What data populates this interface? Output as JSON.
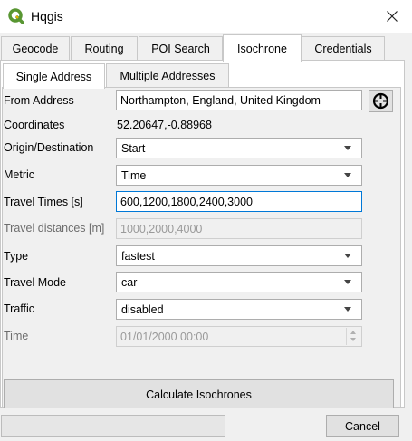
{
  "window": {
    "title": "Hqgis"
  },
  "tabs": [
    "Geocode",
    "Routing",
    "POI Search",
    "Isochrone",
    "Credentials"
  ],
  "active_tab": "Isochrone",
  "subtabs": [
    "Single Address",
    "Multiple Addresses"
  ],
  "active_subtab": "Single Address",
  "form": {
    "from_address": {
      "label": "From Address",
      "value": "Northampton, England, United Kingdom"
    },
    "coordinates": {
      "label": "Coordinates",
      "value": "52.20647,-0.88968"
    },
    "origin_destination": {
      "label": "Origin/Destination",
      "value": "Start"
    },
    "metric": {
      "label": "Metric",
      "value": "Time"
    },
    "travel_times": {
      "label": "Travel Times [s]",
      "value": "600,1200,1800,2400,3000"
    },
    "travel_distances": {
      "label": "Travel distances [m]",
      "placeholder": "1000,2000,4000"
    },
    "type": {
      "label": "Type",
      "value": "fastest"
    },
    "travel_mode": {
      "label": "Travel Mode",
      "value": "car"
    },
    "traffic": {
      "label": "Traffic",
      "value": "disabled"
    },
    "time": {
      "label": "Time",
      "value": "01/01/2000 00:00"
    }
  },
  "buttons": {
    "calculate": "Calculate Isochrones",
    "cancel": "Cancel"
  },
  "colors": {
    "accent": "#0078d7",
    "qgis_green": "#589632",
    "qgis_yellow": "#f0b400"
  }
}
